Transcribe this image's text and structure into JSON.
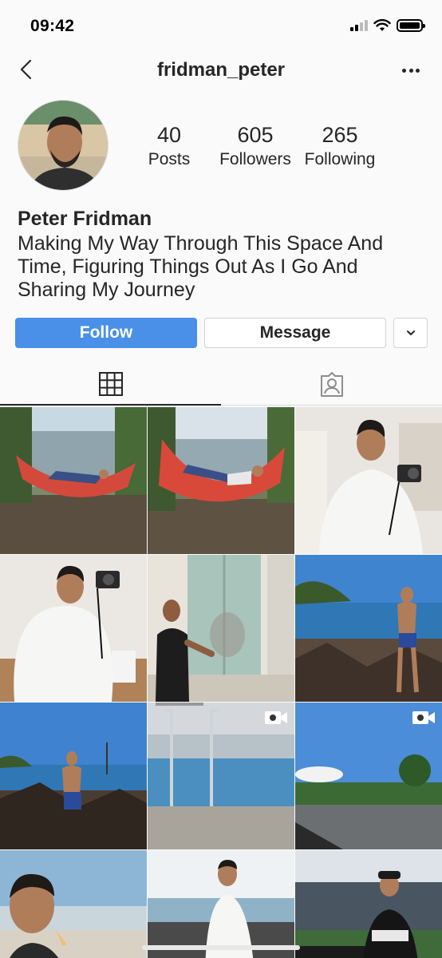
{
  "status_bar": {
    "time": "09:42"
  },
  "header": {
    "username": "fridman_peter"
  },
  "profile": {
    "stats": {
      "posts_count": "40",
      "posts_label": "Posts",
      "followers_count": "605",
      "followers_label": "Followers",
      "following_count": "265",
      "following_label": "Following"
    },
    "name": "Peter Fridman",
    "bio": "Making My Way Through This Space And Time, Figuring Things Out As I Go And Sharing My Journey"
  },
  "actions": {
    "follow_label": "Follow",
    "message_label": "Message"
  },
  "tabs": [
    {
      "icon": "grid-icon",
      "active": true
    },
    {
      "icon": "tagged-icon",
      "active": false
    }
  ],
  "grid": [
    {
      "scene": "hammock-lake",
      "video": false
    },
    {
      "scene": "hammock-lake",
      "video": false
    },
    {
      "scene": "mirror-selfie",
      "video": false
    },
    {
      "scene": "mirror-selfie",
      "video": false
    },
    {
      "scene": "man-by-shutters",
      "video": false
    },
    {
      "scene": "beach-rocks",
      "video": false
    },
    {
      "scene": "beach-rocks",
      "video": false
    },
    {
      "scene": "pool",
      "video": true
    },
    {
      "scene": "parking-lot",
      "video": true
    },
    {
      "scene": "man-eating-icecream",
      "video": false
    },
    {
      "scene": "man-at-beach",
      "video": false
    },
    {
      "scene": "stadium",
      "video": false
    }
  ],
  "colors": {
    "follow_button": "#4a90e8",
    "text": "#262626",
    "background": "#fafafa"
  }
}
